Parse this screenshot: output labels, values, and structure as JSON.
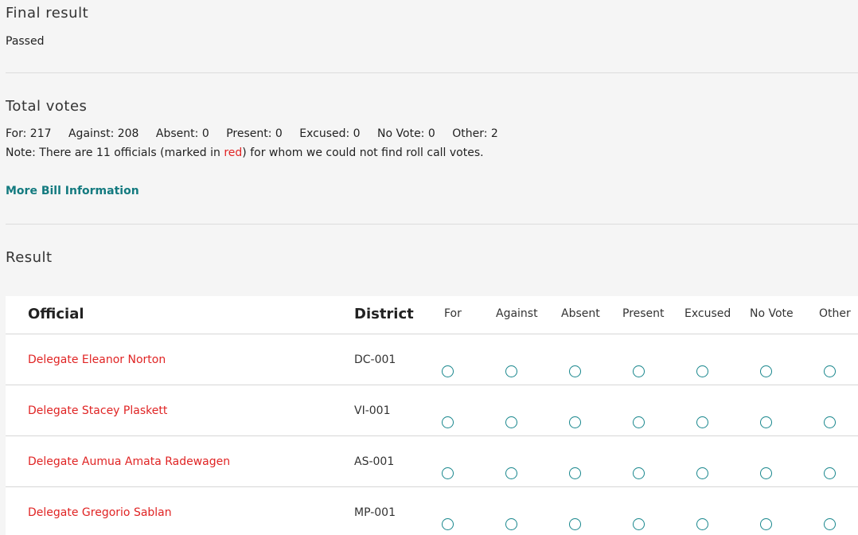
{
  "final_result": {
    "heading": "Final result",
    "value": "Passed"
  },
  "total_votes": {
    "heading": "Total votes",
    "tally": [
      {
        "label": "For: 217"
      },
      {
        "label": "Against: 208"
      },
      {
        "label": "Absent: 0"
      },
      {
        "label": "Present: 0"
      },
      {
        "label": "Excused: 0"
      },
      {
        "label": "No Vote: 0"
      },
      {
        "label": "Other: 2"
      }
    ],
    "note_before": "Note: There are 11 officials (marked in ",
    "note_red": "red",
    "note_after": ") for whom we could not find roll call votes.",
    "more_link": "More Bill Information"
  },
  "result": {
    "heading": "Result",
    "columns": {
      "official": "Official",
      "district": "District",
      "for": "For",
      "against": "Against",
      "absent": "Absent",
      "present": "Present",
      "excused": "Excused",
      "no_vote": "No Vote",
      "other": "Other"
    },
    "rows": [
      {
        "official": "Delegate Eleanor Norton",
        "district": "DC-001"
      },
      {
        "official": "Delegate Stacey Plaskett",
        "district": "VI-001"
      },
      {
        "official": "Delegate Aumua Amata Radewagen",
        "district": "AS-001"
      },
      {
        "official": "Delegate Gregorio Sablan",
        "district": "MP-001"
      }
    ]
  },
  "colors": {
    "missing_vote_red": "#e02424",
    "link_teal": "#137a7f",
    "radio_teal": "#17868c"
  }
}
